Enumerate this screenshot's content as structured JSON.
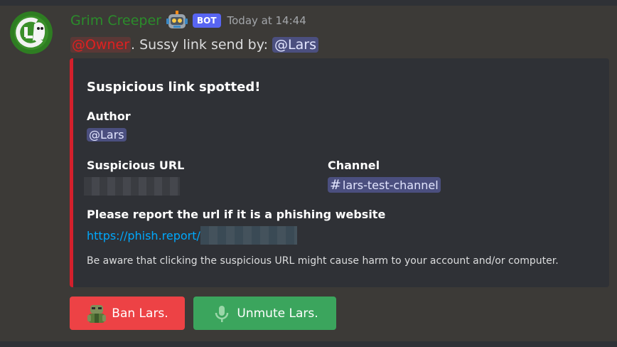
{
  "message": {
    "author": "Grim Creeper",
    "bot_badge": "BOT",
    "timestamp": "Today at 14:44",
    "owner_mention": "@Owner",
    "text": ". Sussy link send by: ",
    "user_mention": "@Lars",
    "author_color": "#2b8c2b"
  },
  "embed": {
    "accent_color": "#d3202c",
    "title": "Suspicious link spotted!",
    "author_field": {
      "name": "Author",
      "value": "@Lars"
    },
    "url_field": {
      "name": "Suspicious URL"
    },
    "channel_field": {
      "name": "Channel",
      "icon": "#",
      "value": "lars-test-channel"
    },
    "report_field": {
      "name": "Please report the url if it is a phishing website",
      "value": "https://phish.report/"
    },
    "footer": "Be aware that clicking the suspicious URL might cause harm to your account and/or computer."
  },
  "buttons": [
    {
      "label": "Ban Lars.",
      "icon": "zombie-emoji-icon",
      "color": "#ed4245"
    },
    {
      "label": "Unmute Lars.",
      "icon": "microphone-icon",
      "color": "#3ba55d"
    }
  ]
}
